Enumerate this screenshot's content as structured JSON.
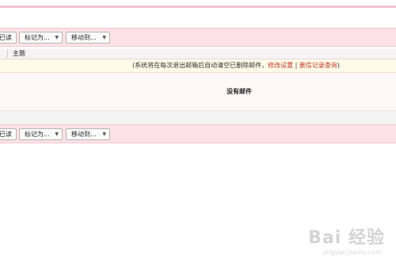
{
  "toolbar_top": {
    "mark_read_partial": "已读",
    "mark_as": "标记为...",
    "move_to": "移动到..."
  },
  "table": {
    "subject_header": "主题"
  },
  "notice": {
    "text_prefix": "(系统将在每次退出邮箱后自动清空已删除邮件，",
    "link_settings": "修改设置",
    "separator": " | ",
    "link_records": "删信记录查询",
    "text_suffix": ")"
  },
  "empty_state": {
    "message": "没有邮件"
  },
  "toolbar_bottom": {
    "mark_read_partial": "已读",
    "mark_as": "标记为...",
    "move_to": "移动到..."
  },
  "watermark": {
    "logo_text": "Bai 经验",
    "url": "jingyan.baidu.com"
  },
  "colors": {
    "toolbar_bg": "#fde2e7",
    "accent_border": "#f3c4ce",
    "link": "#c0392b",
    "notice_bg": "#fffbe9"
  },
  "icons": {
    "dropdown": "caret-down-icon"
  }
}
